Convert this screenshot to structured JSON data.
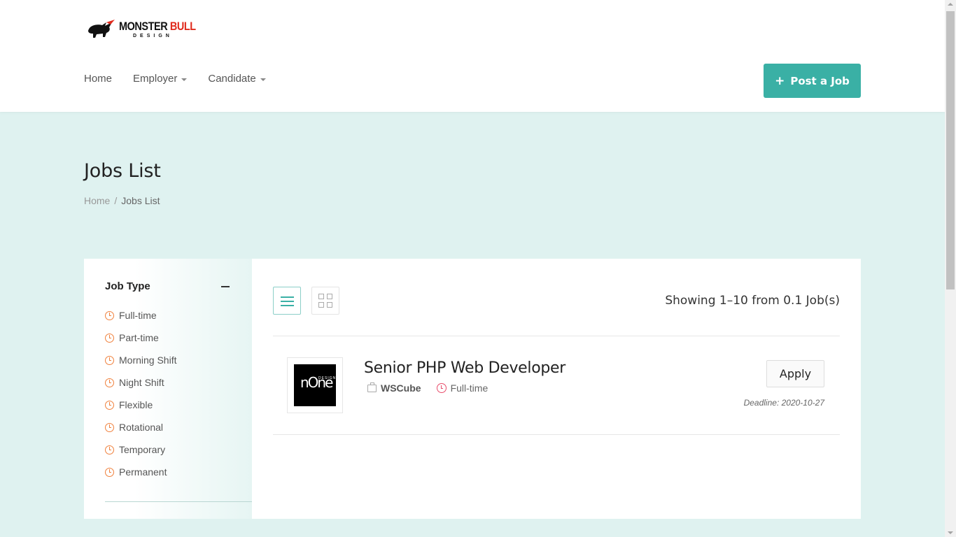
{
  "brand": {
    "logo_main_1": "MONSTER",
    "logo_main_2": " BULL",
    "logo_sub": "DESIGN"
  },
  "nav": {
    "items": [
      {
        "label": "Home"
      },
      {
        "label": "Employer"
      },
      {
        "label": "Candidate"
      }
    ]
  },
  "header": {
    "post_job_label": "Post a Job",
    "post_job_icon": "+"
  },
  "page": {
    "title": "Jobs List"
  },
  "breadcrumb": {
    "home": "Home",
    "separator": "/",
    "current": "Jobs List"
  },
  "filters": {
    "title": "Job Type",
    "types": [
      "Full-time",
      "Part-time",
      "Morning Shift",
      "Night Shift",
      "Flexible",
      "Rotational",
      "Temporary",
      "Permanent"
    ]
  },
  "listing": {
    "showing_text": "Showing 1–10 from 0.1 Job(s)"
  },
  "jobs": [
    {
      "title": "Senior PHP Web Developer",
      "company": "WSCube",
      "type": "Full-time",
      "apply_label": "Apply",
      "deadline": "Deadline: 2020-10-27",
      "logo_big": "nOne",
      "logo_small": "DESIGN"
    }
  ],
  "colors": {
    "accent": "#3ab0a5",
    "page_bg": "#dff2f0",
    "filter_icon": "#f0803c",
    "type_icon": "#e84c6b"
  }
}
